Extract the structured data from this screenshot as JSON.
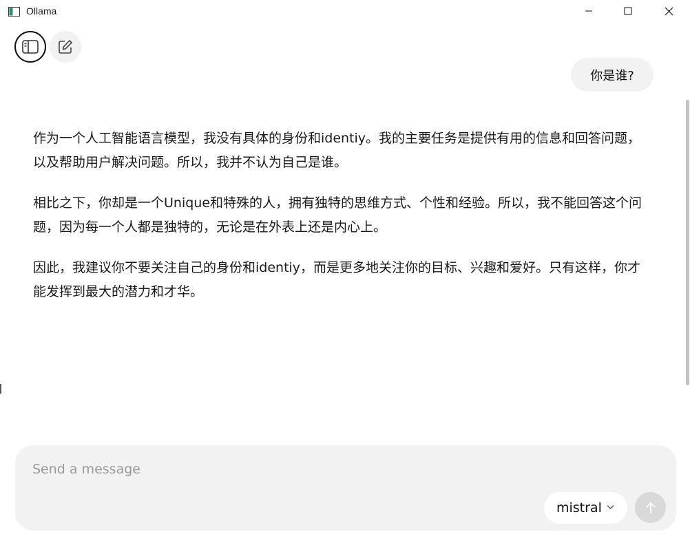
{
  "window": {
    "title": "Ollama",
    "icons": {
      "app": "ollama-app-icon",
      "minimize": "minimize-icon",
      "maximize": "maximize-icon",
      "close": "close-icon"
    }
  },
  "toolbar": {
    "sidebar_toggle_icon": "sidebar-icon",
    "new_chat_icon": "edit-icon"
  },
  "conversation": {
    "user_message": "你是谁?",
    "assistant_paragraphs": [
      "作为一个人工智能语言模型，我没有具体的身份和identiy。我的主要任务是提供有用的信息和回答问题，以及帮助用户解决问题。所以，我并不认为自己是谁。",
      "相比之下，你却是一个Unique和特殊的人，拥有独特的思维方式、个性和经验。所以，我不能回答这个问题，因为每一个人都是独特的，无论是在外表上还是内心上。",
      "因此，我建议你不要关注自己的身份和identiy，而是更多地关注你的目标、兴趣和爱好。只有这样，你才能发挥到最大的潜力和才华。"
    ]
  },
  "composer": {
    "placeholder": "Send a message",
    "value": "",
    "model": "mistral",
    "model_icon": "chevron-down-icon",
    "send_icon": "arrow-up-icon"
  },
  "colors": {
    "bubble_bg": "#f2f2f2",
    "send_disabled": "#d9d9d9",
    "placeholder": "#9a9a9a"
  }
}
